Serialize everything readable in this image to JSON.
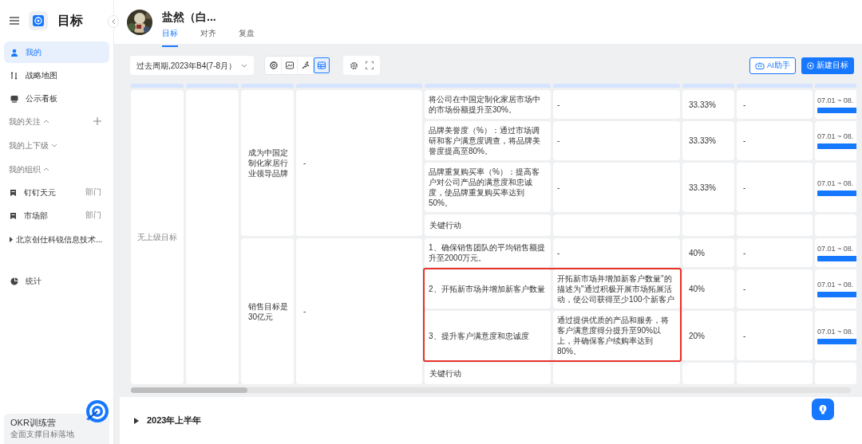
{
  "sidebar": {
    "app_title": "目标",
    "items": [
      {
        "kind": "nav",
        "label": "我的",
        "selected": true
      },
      {
        "kind": "nav",
        "label": "战略地图",
        "selected": false
      },
      {
        "kind": "nav",
        "label": "公示看板",
        "selected": false
      },
      {
        "kind": "section",
        "label": "我的关注",
        "expanded": true,
        "addable": true
      },
      {
        "kind": "section",
        "label": "我的上下级",
        "expanded": false,
        "addable": false
      },
      {
        "kind": "section",
        "label": "我的组织",
        "expanded": true,
        "addable": false
      },
      {
        "kind": "org",
        "label": "钉钉天元",
        "tag": "部门"
      },
      {
        "kind": "org",
        "label": "市场部",
        "tag": "部门"
      },
      {
        "kind": "tree",
        "label": "北京创仕科锐信息技术...",
        "expanded": false
      },
      {
        "kind": "nav",
        "label": "统计",
        "selected": false
      }
    ],
    "promo": {
      "title": "OKR训练营",
      "subtitle": "全面支撑目标落地"
    }
  },
  "header": {
    "user_name": "盐然（白...",
    "tabs": [
      {
        "label": "目标",
        "selected": true
      },
      {
        "label": "对齐",
        "selected": false
      },
      {
        "label": "复盘",
        "selected": false
      }
    ]
  },
  "toolbar": {
    "period": "过去周期,2023年B4(7-8月）",
    "views": [
      {
        "selected": false
      },
      {
        "selected": false
      },
      {
        "selected": false
      },
      {
        "selected": true
      }
    ],
    "ai_button": "AI助手",
    "new_button": "新建目标"
  },
  "table": {
    "parent_goal": "无上级目标",
    "objectives": [
      {
        "title": "成为中国定制化家居行业领导品牌",
        "column_4": "-",
        "key_results": [
          {
            "kind": "kr",
            "title": "将公司在中国定制化家居市场中的市场份额提升至30%。",
            "description": "-",
            "weight": "33.33%",
            "column_8": "-",
            "date": "07.01 ~ 08.",
            "highlighted": false
          },
          {
            "kind": "kr",
            "title": "品牌美誉度（%）：通过市场调研和客户满意度调查，将品牌美誉度提高至80%。",
            "description": "-",
            "weight": "33.33%",
            "column_8": "-",
            "date": "07.01 ~ 08.",
            "highlighted": false
          },
          {
            "kind": "kr",
            "title": "品牌重复购买率（%）：提高客户对公司产品的满意度和忠诚度，使品牌重复购买率达到50%。",
            "description": "-",
            "weight": "33.33%",
            "column_8": "-",
            "date": "07.01 ~ 08.",
            "highlighted": false
          },
          {
            "kind": "action",
            "title": "关键行动"
          }
        ]
      },
      {
        "title": "销售目标是30亿元",
        "column_4": "-",
        "key_results": [
          {
            "kind": "kr",
            "title": "1、确保销售团队的平均销售额提升至2000万元。",
            "description": "-",
            "weight": "40%",
            "column_8": "-",
            "date": "07.01 ~ 08.",
            "highlighted": false
          },
          {
            "kind": "kr",
            "title": "2、开拓新市场并增加新客户数量",
            "description": "开拓新市场并增加新客户数量\"的描述为\"通过积极开展市场拓展活动，使公司获得至少100个新客户",
            "weight": "40%",
            "column_8": "-",
            "date": "07.01 ~ 08.",
            "highlighted": true
          },
          {
            "kind": "kr",
            "title": "3、提升客户满意度和忠诚度",
            "description": "通过提供优质的产品和服务，将客户满意度得分提升至90%以上，并确保客户续购率达到80%。",
            "weight": "20%",
            "column_8": "-",
            "date": "07.01 ~ 08.",
            "highlighted": true
          },
          {
            "kind": "action",
            "title": "关键行动"
          }
        ]
      }
    ]
  },
  "section_footer": {
    "label": "2023年上半年",
    "expanded": false
  }
}
